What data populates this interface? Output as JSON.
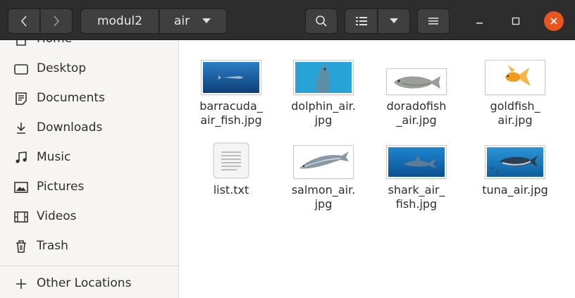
{
  "header": {
    "breadcrumb": [
      "modul2",
      "air"
    ],
    "close_color": "#e9541f"
  },
  "sidebar": {
    "items": [
      {
        "label": "Home",
        "icon": "home-icon"
      },
      {
        "label": "Desktop",
        "icon": "desktop-icon"
      },
      {
        "label": "Documents",
        "icon": "documents-icon"
      },
      {
        "label": "Downloads",
        "icon": "downloads-icon"
      },
      {
        "label": "Music",
        "icon": "music-icon"
      },
      {
        "label": "Pictures",
        "icon": "pictures-icon"
      },
      {
        "label": "Videos",
        "icon": "videos-icon"
      },
      {
        "label": "Trash",
        "icon": "trash-icon"
      }
    ],
    "other_locations": {
      "label": "Other Locations",
      "icon": "plus-icon"
    }
  },
  "files": [
    {
      "name": "barracuda_\nair_fish.jpg",
      "icon": "barracuda-thumbnail"
    },
    {
      "name": "dolphin_air.\njpg",
      "icon": "dolphin-thumbnail"
    },
    {
      "name": "doradofish\n_air.jpg",
      "icon": "dorado-fish-thumbnail"
    },
    {
      "name": "goldfish_\nair.jpg",
      "icon": "goldfish-thumbnail"
    },
    {
      "name": "list.txt",
      "icon": "text-file-icon"
    },
    {
      "name": "salmon_air.\njpg",
      "icon": "salmon-thumbnail"
    },
    {
      "name": "shark_air_\nfish.jpg",
      "icon": "shark-thumbnail"
    },
    {
      "name": "tuna_air.jpg",
      "icon": "tuna-thumbnail"
    }
  ]
}
